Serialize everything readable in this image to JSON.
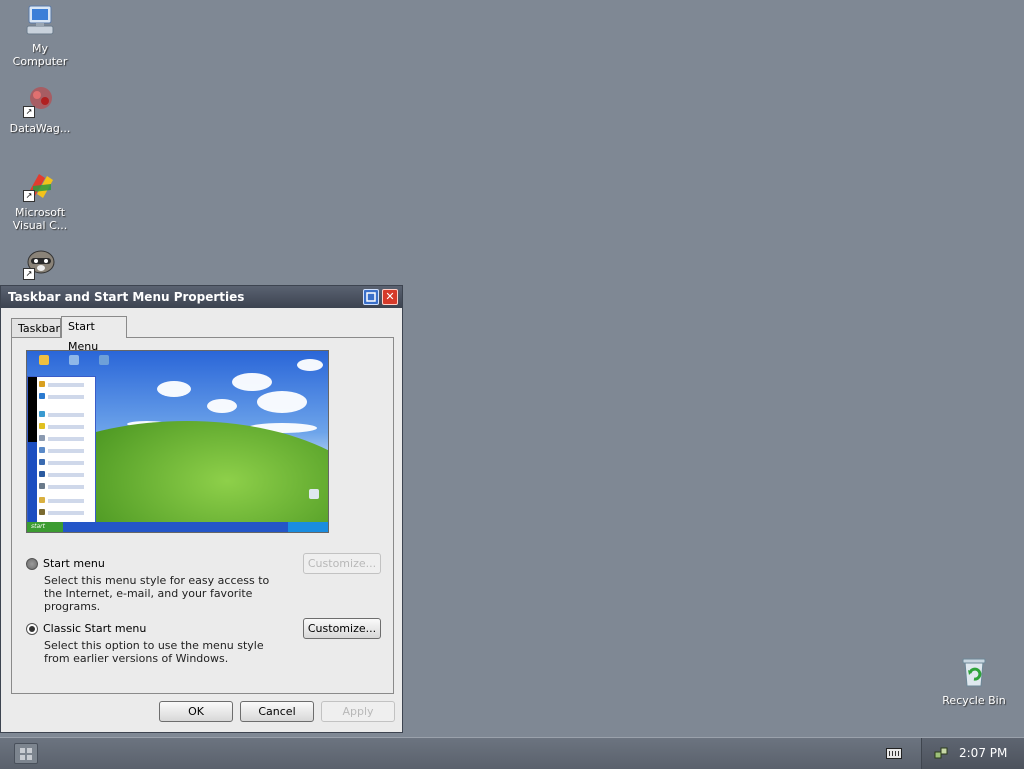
{
  "desktop": {
    "icons": [
      {
        "label": "My\nComputer",
        "icon": "my-computer-icon"
      },
      {
        "label": "DataWag...",
        "icon": "datawag-icon"
      },
      {
        "label": "Microsoft\nVisual C...",
        "icon": "visual-c-icon"
      },
      {
        "label": "",
        "icon": "raccoon-icon"
      },
      {
        "label": "Recycle Bin",
        "icon": "recycle-bin-icon"
      }
    ]
  },
  "dialog": {
    "title": "Taskbar and Start Menu Properties",
    "tabs": [
      {
        "label": "Taskbar",
        "active": false
      },
      {
        "label": "Start Menu",
        "active": true
      }
    ],
    "preview": {
      "start_label": "start"
    },
    "options": [
      {
        "label": "Start menu",
        "description": "Select this menu style for easy access to the Internet, e-mail, and your favorite programs.",
        "selected": false,
        "button_label": "Customize...",
        "button_enabled": false
      },
      {
        "label": "Classic Start menu",
        "description": "Select this option to use the menu style from earlier versions of Windows.",
        "selected": true,
        "button_label": "Customize...",
        "button_enabled": true
      }
    ],
    "buttons": {
      "ok": "OK",
      "cancel": "Cancel",
      "apply": "Apply"
    }
  },
  "taskbar": {
    "clock": "2:07 PM"
  },
  "colors": {
    "desktop_bg": "#7f8894",
    "titlebar": "#3c4350",
    "taskbar": "#5a616c"
  }
}
